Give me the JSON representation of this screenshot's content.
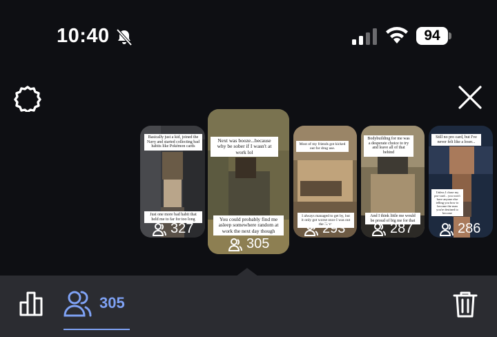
{
  "status_bar": {
    "time": "10:40",
    "battery": "94",
    "icons": [
      "bell-slash-icon",
      "cellular-signal-icon",
      "wifi-icon",
      "battery-icon"
    ]
  },
  "header": {
    "settings_icon": "gear-icon",
    "close_icon": "close-icon"
  },
  "stories": [
    {
      "caption_top": "Basically just a kid, joined the Navy and started collecting bad habits like Pokémon cards",
      "caption_bottom": "Just one more bad habit that held me to far for too long",
      "views": "327",
      "colors": [
        "#3a3b3f",
        "#6a5b47",
        "#b9a58a"
      ]
    },
    {
      "caption_top": "Next was booze...because why be sober if I wasn't at work lol",
      "caption_bottom": "You could probably find me asleep somewhere random at work the next day though",
      "views": "305",
      "colors": [
        "#6c6646",
        "#8d7f52",
        "#4d4a3a"
      ]
    },
    {
      "caption_top": "Most of my friends got kicked out for drug use.",
      "caption_bottom": "I always managed to get by, but it only got worse once I was out the Navy",
      "views": "293",
      "colors": [
        "#7d6a4e",
        "#c0a37b",
        "#5d4c39"
      ]
    },
    {
      "caption_top": "Bodybuilding for me was a desperate choice to try and leave all of that behind",
      "caption_bottom": "And I think little me would be proud of big me for that",
      "views": "287",
      "colors": [
        "#7b6f55",
        "#a69170",
        "#3e3a33"
      ]
    },
    {
      "caption_top": "Still no pro card, but I've never felt like a loser...",
      "caption_bottom": "Unless I chase my pro-card... you won't have anyone else telling you how to become the man you're destined to become",
      "views": "286",
      "colors": [
        "#1d2a3f",
        "#5d4a3e",
        "#a97a5b"
      ]
    }
  ],
  "bottom_bar": {
    "insights_icon": "bar-chart-icon",
    "viewers_icon": "viewers-icon",
    "viewers_count": "305",
    "delete_icon": "trash-icon",
    "accent": "#7fa2f5"
  }
}
